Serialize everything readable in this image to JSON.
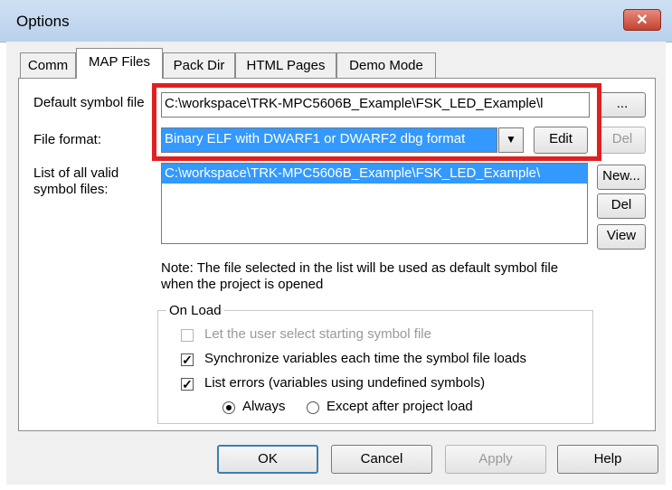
{
  "window": {
    "title": "Options",
    "close_label": "✕"
  },
  "tabs": [
    {
      "label": "Comm"
    },
    {
      "label": "MAP Files"
    },
    {
      "label": "Pack Dir"
    },
    {
      "label": "HTML Pages"
    },
    {
      "label": "Demo Mode"
    }
  ],
  "map": {
    "default_symbol_file_label": "Default symbol file",
    "default_symbol_file_value": "C:\\workspace\\TRK-MPC5606B_Example\\FSK_LED_Example\\l",
    "browse_label": "...",
    "file_format_label": "File format:",
    "file_format_value": "Binary ELF with DWARF1 or DWARF2 dbg format",
    "dropdown_arrow": "▼",
    "edit_label": "Edit",
    "del_top_label": "Del",
    "list_label_line1": "List of all valid",
    "list_label_line2": "symbol files:",
    "list_items": [
      "C:\\workspace\\TRK-MPC5606B_Example\\FSK_LED_Example\\"
    ],
    "new_label": "New...",
    "del_label": "Del",
    "view_label": "View",
    "note_line1": "Note: The file selected in the list will be used as default symbol file",
    "note_line2": "when the project is opened"
  },
  "on_load": {
    "title": "On Load",
    "let_user_select": "Let the user select starting symbol file",
    "sync_vars": "Synchronize variables each time the symbol file loads",
    "list_errors": "List errors (variables using undefined symbols)",
    "always": "Always",
    "except_after": "Except after project load",
    "checkmark": "✓"
  },
  "buttons": {
    "ok": "OK",
    "cancel": "Cancel",
    "apply": "Apply",
    "help": "Help"
  },
  "colors": {
    "highlight": "#e02020",
    "selection": "#3399ff"
  }
}
